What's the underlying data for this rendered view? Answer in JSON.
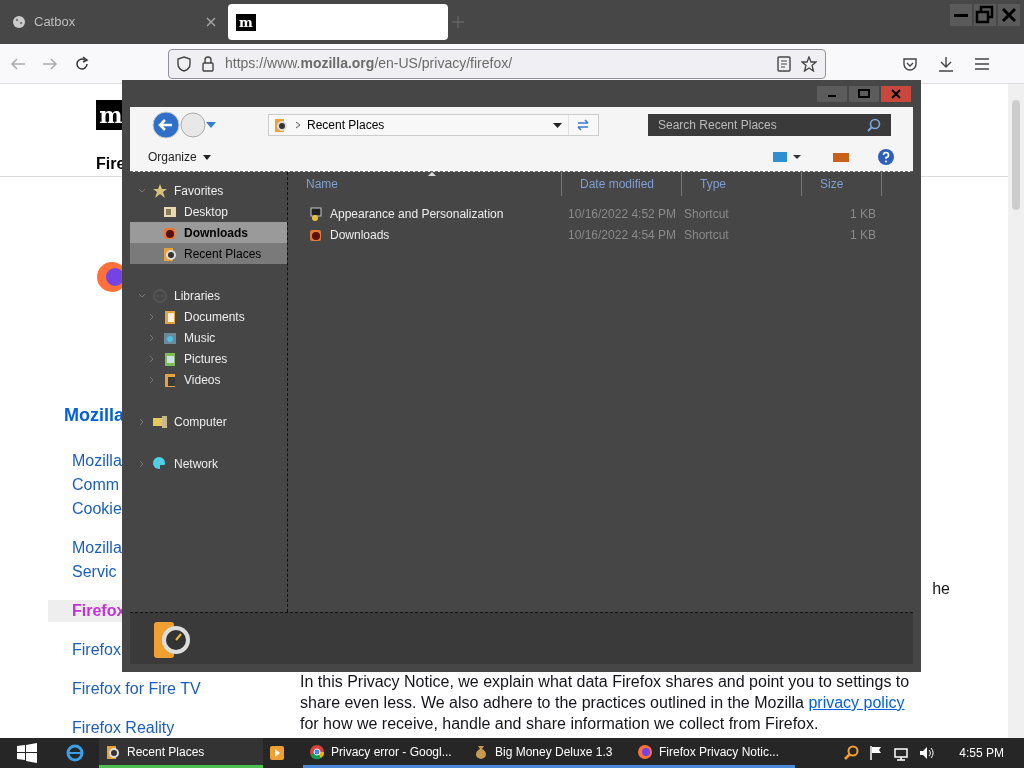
{
  "browser": {
    "tabs": [
      {
        "label": "Catbox",
        "selected": false,
        "kind": "favicon"
      },
      {
        "label": "m",
        "selected": true,
        "kind": "logo"
      }
    ],
    "url": "https://www.**mozilla.org**/en-US/privacy/firefox/"
  },
  "page": {
    "logo": "m",
    "nav_tab": "Fire",
    "heading": "Mozilla",
    "links": [
      {
        "label": "Mozilla",
        "selected": false
      },
      {
        "label": "Comm",
        "selected": false
      },
      {
        "label": "Cookie",
        "selected": false
      },
      {
        "label": "Mozilla",
        "selected": false
      },
      {
        "label": "Servic",
        "selected": false
      },
      {
        "label": "Firefox",
        "selected": true
      },
      {
        "label": "Firefox",
        "selected": false
      },
      {
        "label": "Firefox for Fire TV",
        "selected": false
      },
      {
        "label": "Firefox Reality",
        "selected": false
      }
    ],
    "line_end": "he",
    "paragraph": "In this Privacy Notice, we explain what data Firefox shares and point you to settings to share even less. We also adhere to the practices outlined in the Mozilla ",
    "paragraph_link": "privacy policy",
    "paragraph_end": " for how we receive, handle and share information we collect from Firefox."
  },
  "explorer": {
    "address": "Recent Places",
    "search_placeholder": "Search Recent Places",
    "organize": "Organize",
    "nav": [
      {
        "label": "Favorites",
        "expanded": true,
        "children": [
          {
            "label": "Desktop",
            "selected": false,
            "hovered": false
          },
          {
            "label": "Downloads",
            "selected": false,
            "hovered": true
          },
          {
            "label": "Recent Places",
            "selected": true,
            "hovered": false
          }
        ]
      },
      {
        "label": "Libraries",
        "expanded": true,
        "children": [
          {
            "label": "Documents",
            "expanded": false
          },
          {
            "label": "Music",
            "expanded": false
          },
          {
            "label": "Pictures",
            "expanded": false
          },
          {
            "label": "Videos",
            "expanded": false
          }
        ]
      },
      {
        "label": "Computer",
        "expanded": false
      },
      {
        "label": "Network",
        "expanded": false
      }
    ],
    "columns": [
      "Name",
      "Date modified",
      "Type",
      "Size"
    ],
    "files": [
      {
        "name": "Appearance and Personalization",
        "date": "10/16/2022 4:52 PM",
        "type": "Shortcut",
        "size": "1 KB"
      },
      {
        "name": "Downloads",
        "date": "10/16/2022 4:54 PM",
        "type": "Shortcut",
        "size": "1 KB"
      }
    ]
  },
  "taskbar": {
    "items": [
      {
        "label": "Recent Places",
        "selected": true
      },
      {
        "label": "Privacy error - Googl...",
        "selected": false
      },
      {
        "label": "Big Money Deluxe 1.3",
        "selected": false
      },
      {
        "label": "Firefox Privacy Notic...",
        "selected": false
      }
    ],
    "clock": "4:55 PM"
  }
}
